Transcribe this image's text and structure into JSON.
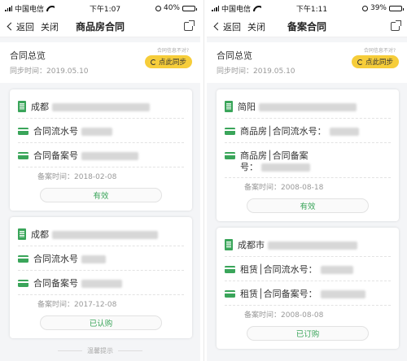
{
  "left": {
    "status": {
      "carrier": "中国电信",
      "time": "下午1:07",
      "battery": "40%",
      "battery_level": 0.4
    },
    "nav": {
      "back": "返回",
      "close": "关闭",
      "title": "商品房合同"
    },
    "overview": {
      "title": "合同总览",
      "sync_date": "同步时间：2019.05.10",
      "hint": "合同信息不对?",
      "sync_button": "点此同步"
    },
    "cards": [
      {
        "title": "成都",
        "flow_label": "合同流水号",
        "filing_label": "合同备案号",
        "date": "备案时间：2018-02-08",
        "status": "有效"
      },
      {
        "title": "成都",
        "flow_label": "合同流水号",
        "filing_label": "合同备案号",
        "date": "备案时间：2017-12-08",
        "status": "已认购"
      }
    ],
    "tip": "温馨提示"
  },
  "right": {
    "status": {
      "carrier": "中国电信",
      "time": "下午1:11",
      "battery": "39%",
      "battery_level": 0.39
    },
    "nav": {
      "back": "返回",
      "close": "关闭",
      "title": "备案合同"
    },
    "overview": {
      "title": "合同总览",
      "sync_date": "同步时间：2019.05.10",
      "hint": "合同信息不对?",
      "sync_button": "点此同步"
    },
    "cards": [
      {
        "title": "简阳",
        "flow_label": "商品房│合同流水号：",
        "filing_label_1": "商品房│合同备案",
        "filing_label_2": "号：",
        "date": "备案时间：2008-08-18",
        "status": "有效"
      },
      {
        "title": "成都市",
        "flow_label": "租赁│合同流水号：",
        "filing_label": "租赁│合同备案号：",
        "date": "备案时间：2008-08-08",
        "status": "已订购"
      }
    ]
  },
  "colors": {
    "accent_green": "#3aa55a",
    "sync_yellow": "#f6cd3a"
  }
}
